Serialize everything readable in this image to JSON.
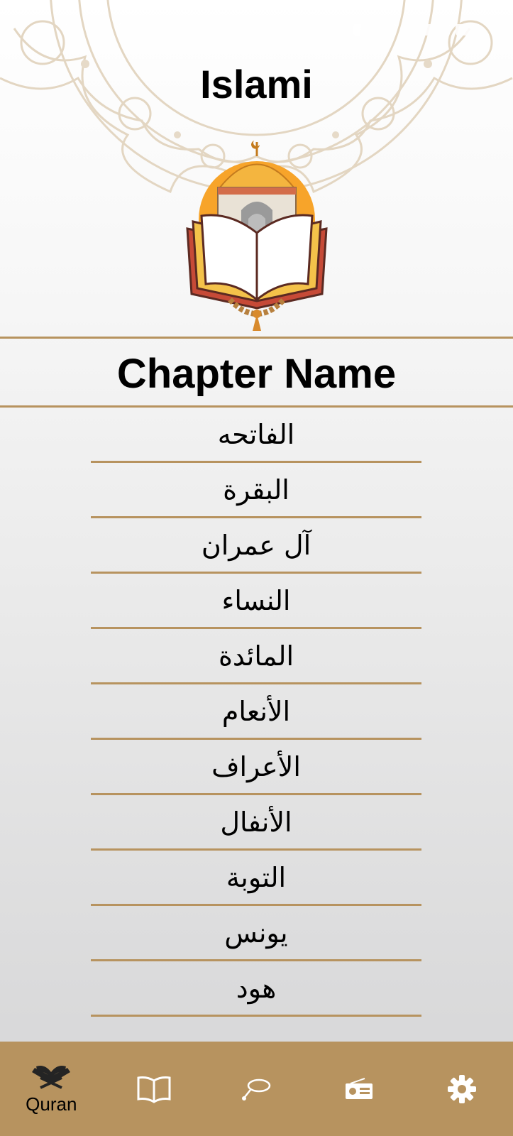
{
  "app": {
    "title": "Islami"
  },
  "list_header": "Chapter Name",
  "chapters": [
    "الفاتحه",
    "البقرة",
    "آل عمران",
    "النساء",
    "المائدة",
    "الأنعام",
    "الأعراف",
    "الأنفال",
    "التوبة",
    "يونس",
    "هود"
  ],
  "nav": {
    "selected": "quran",
    "items": [
      {
        "id": "quran",
        "icon": "quran-book-icon",
        "label": "Quran"
      },
      {
        "id": "hadith",
        "icon": "open-book-icon",
        "label": ""
      },
      {
        "id": "sebha",
        "icon": "sebha-icon",
        "label": ""
      },
      {
        "id": "radio",
        "icon": "radio-icon",
        "label": ""
      },
      {
        "id": "settings",
        "icon": "gear-icon",
        "label": ""
      }
    ]
  },
  "colors": {
    "accent": "#B7935F",
    "selected_icon": "#242424",
    "unselected_icon": "#FFFFFF"
  }
}
